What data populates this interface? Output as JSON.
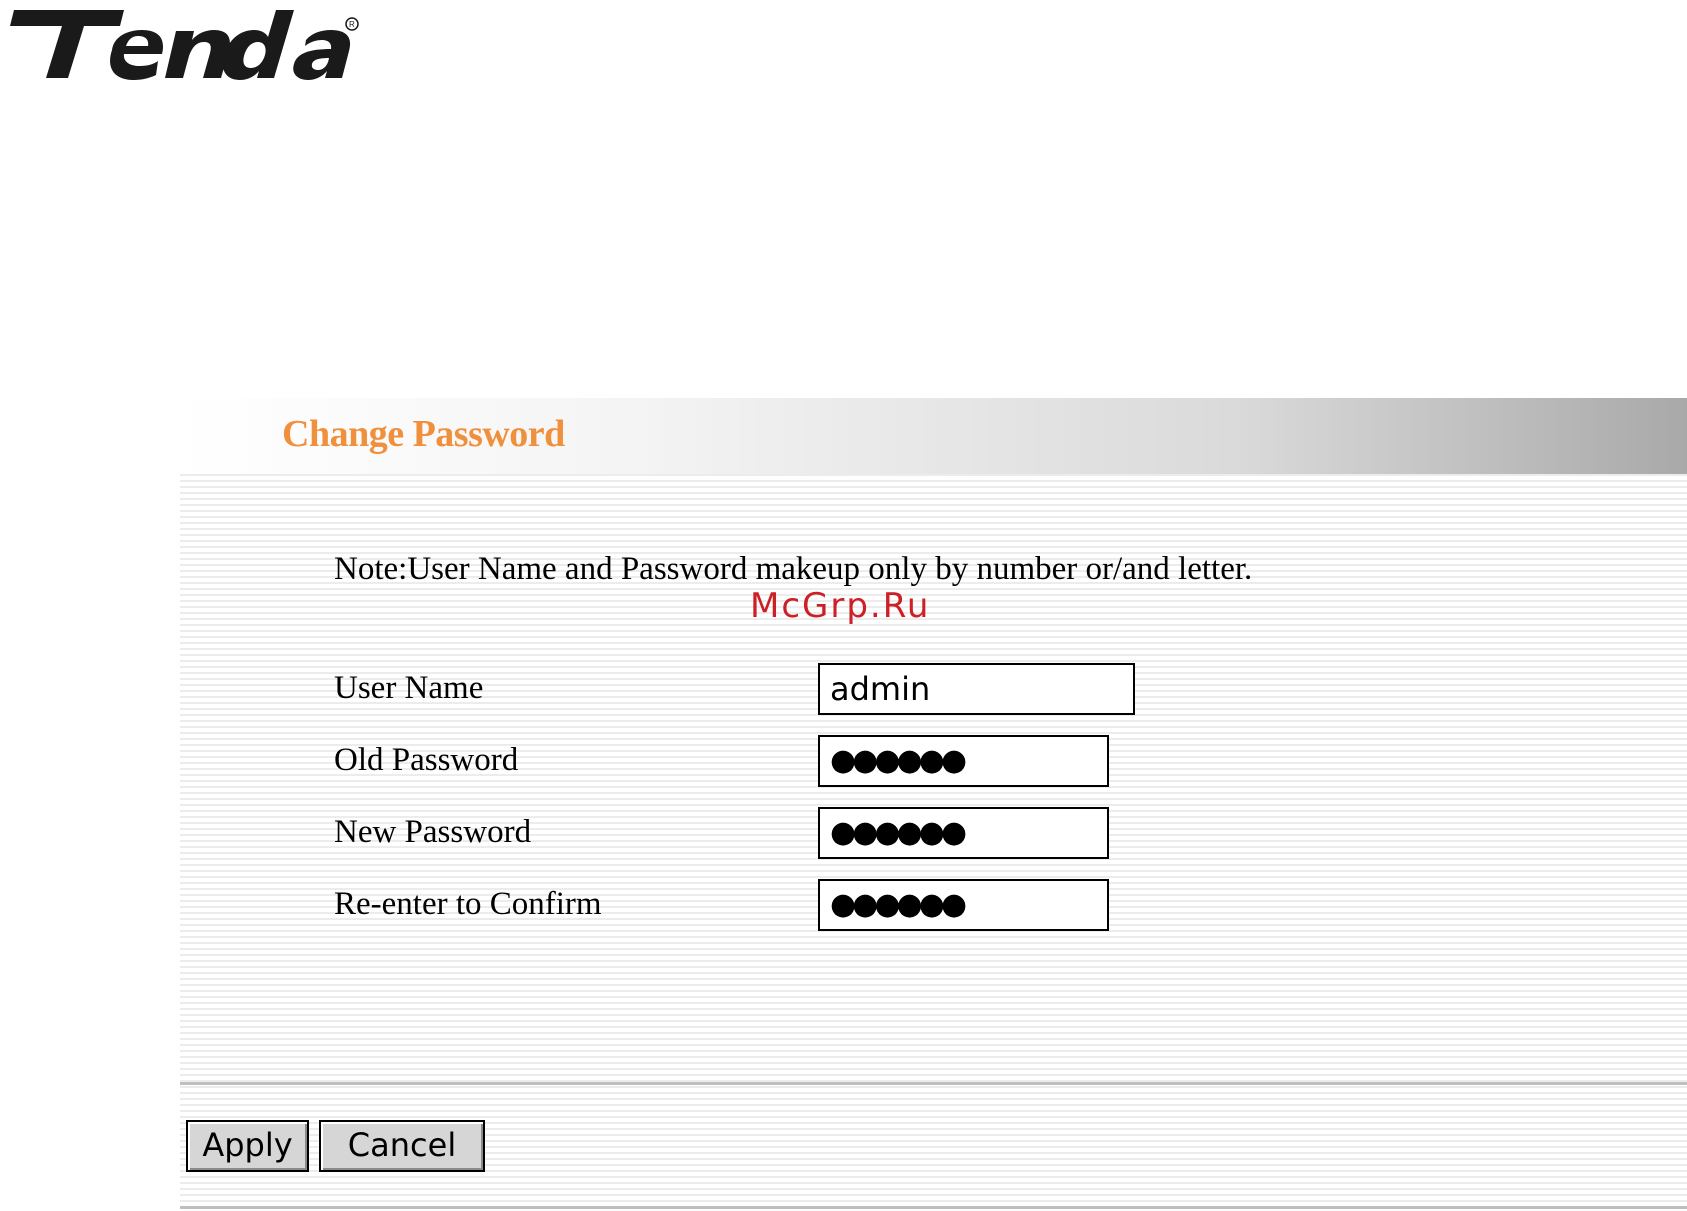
{
  "brand": {
    "logo_text": "Tenda",
    "logo_color": "#1a1a1a"
  },
  "panel": {
    "title": "Change Password",
    "title_color": "#f0903c",
    "note": "Note:User Name and Password makeup only by number or/and letter.",
    "watermark": "McGrp.Ru",
    "watermark_color": "#cc1f26"
  },
  "form": {
    "user_name": {
      "label": "User Name",
      "value": "admin"
    },
    "old_password": {
      "label": "Old Password",
      "value": "●●●●●●"
    },
    "new_password": {
      "label": "New Password",
      "value": "●●●●●●"
    },
    "confirm_password": {
      "label": "Re-enter to Confirm",
      "value": "●●●●●●"
    }
  },
  "buttons": {
    "apply": "Apply",
    "cancel": "Cancel"
  }
}
